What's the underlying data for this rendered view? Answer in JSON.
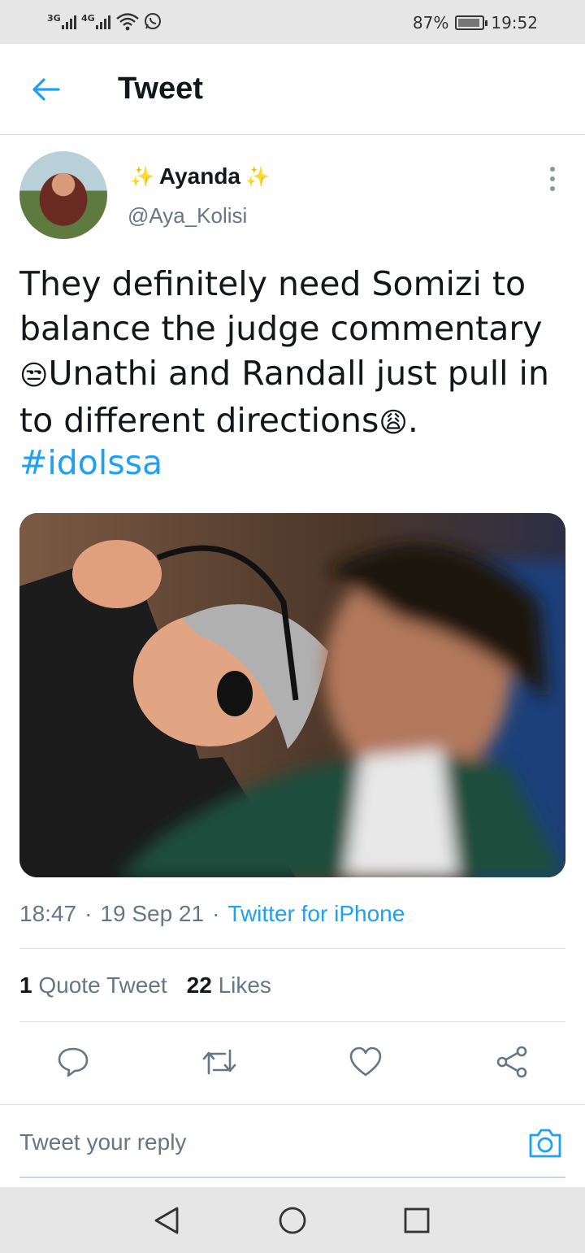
{
  "status_bar": {
    "sim1_network": "3G",
    "sim2_network": "4G",
    "battery": "87%",
    "time": "19:52",
    "icons": [
      "signal-icon",
      "wifi-icon",
      "whatsapp-icon",
      "battery-icon"
    ]
  },
  "header": {
    "title": "Tweet",
    "back_icon": "back-arrow-icon"
  },
  "tweet": {
    "display_name": "Ayanda",
    "name_decoration": "✨",
    "handle": "@Aya_Kolisi",
    "text_line1": "They definitely need Somizi to balance the judge commentary ",
    "emoji1": "😒",
    "text_line2": "Unathi and Randall just pull in to different directions",
    "emoji2": "😩",
    "text_end": ".",
    "hashtag": "#idolssa",
    "time": "18:47",
    "date": "19 Sep 21",
    "source": "Twitter for iPhone",
    "separator": "·"
  },
  "stats": {
    "quote_count": "1",
    "quote_label": "Quote Tweet",
    "like_count": "22",
    "like_label": "Likes"
  },
  "actions": [
    "reply-icon",
    "retweet-icon",
    "like-icon",
    "share-icon"
  ],
  "reply": {
    "placeholder": "Tweet your reply",
    "camera_icon": "camera-icon"
  },
  "nav": [
    "back-triangle-icon",
    "home-circle-icon",
    "recents-square-icon"
  ],
  "colors": {
    "accent": "#1da1f2",
    "text": "#14171a",
    "secondary": "#657786",
    "divider": "#dfe3e6"
  }
}
